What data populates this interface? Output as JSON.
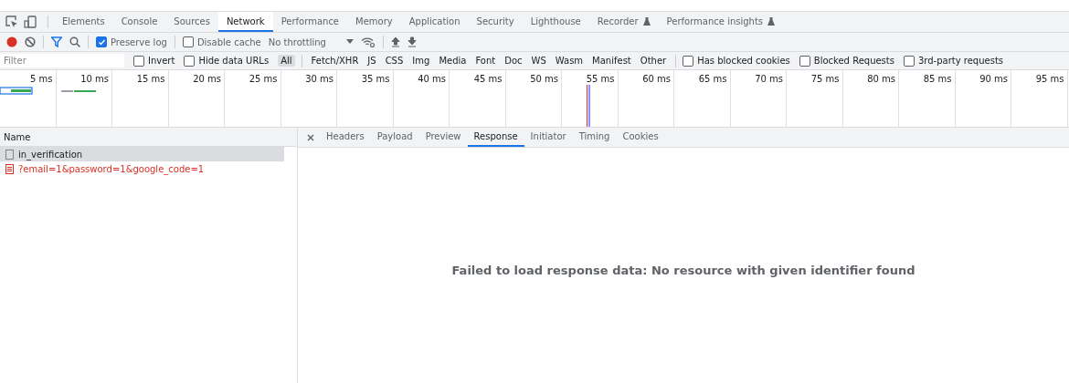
{
  "panel_tabs": [
    {
      "label": "Elements",
      "selected": false,
      "experimental": false
    },
    {
      "label": "Console",
      "selected": false,
      "experimental": false
    },
    {
      "label": "Sources",
      "selected": false,
      "experimental": false
    },
    {
      "label": "Network",
      "selected": true,
      "experimental": false
    },
    {
      "label": "Performance",
      "selected": false,
      "experimental": false
    },
    {
      "label": "Memory",
      "selected": false,
      "experimental": false
    },
    {
      "label": "Application",
      "selected": false,
      "experimental": false
    },
    {
      "label": "Security",
      "selected": false,
      "experimental": false
    },
    {
      "label": "Lighthouse",
      "selected": false,
      "experimental": false
    },
    {
      "label": "Recorder",
      "selected": false,
      "experimental": true
    },
    {
      "label": "Performance insights",
      "selected": false,
      "experimental": true
    }
  ],
  "toolbar": {
    "recording": true,
    "preserve_log": {
      "label": "Preserve log",
      "checked": true
    },
    "disable_cache": {
      "label": "Disable cache",
      "checked": false
    },
    "throttling": "No throttling"
  },
  "filter_bar": {
    "placeholder": "Filter",
    "options": [
      {
        "label": "Invert",
        "checked": false
      },
      {
        "label": "Hide data URLs",
        "checked": false
      }
    ],
    "types": [
      {
        "label": "All",
        "selected": true
      },
      {
        "label": "Fetch/XHR",
        "selected": false
      },
      {
        "label": "JS",
        "selected": false
      },
      {
        "label": "CSS",
        "selected": false
      },
      {
        "label": "Img",
        "selected": false
      },
      {
        "label": "Media",
        "selected": false
      },
      {
        "label": "Font",
        "selected": false
      },
      {
        "label": "Doc",
        "selected": false
      },
      {
        "label": "WS",
        "selected": false
      },
      {
        "label": "Wasm",
        "selected": false
      },
      {
        "label": "Manifest",
        "selected": false
      },
      {
        "label": "Other",
        "selected": false
      }
    ],
    "extra_options": [
      {
        "label": "Has blocked cookies",
        "checked": false
      },
      {
        "label": "Blocked Requests",
        "checked": false
      },
      {
        "label": "3rd-party requests",
        "checked": false
      }
    ]
  },
  "timeline": {
    "ticks": [
      "5 ms",
      "10 ms",
      "15 ms",
      "20 ms",
      "25 ms",
      "30 ms",
      "35 ms",
      "40 ms",
      "45 ms",
      "50 ms",
      "55 ms",
      "60 ms",
      "65 ms",
      "70 ms",
      "75 ms",
      "80 ms",
      "85 ms",
      "90 ms",
      "95 ms"
    ]
  },
  "requests": {
    "column": "Name",
    "rows": [
      {
        "name": "in_verification",
        "selected": true,
        "failed": false
      },
      {
        "name": "?email=1&password=1&google_code=1",
        "selected": false,
        "failed": true
      }
    ]
  },
  "details": {
    "tabs": [
      {
        "label": "Headers",
        "selected": false
      },
      {
        "label": "Payload",
        "selected": false
      },
      {
        "label": "Preview",
        "selected": false
      },
      {
        "label": "Response",
        "selected": true
      },
      {
        "label": "Initiator",
        "selected": false
      },
      {
        "label": "Timing",
        "selected": false
      },
      {
        "label": "Cookies",
        "selected": false
      }
    ],
    "message": "Failed to load response data: No resource with given identifier found"
  }
}
